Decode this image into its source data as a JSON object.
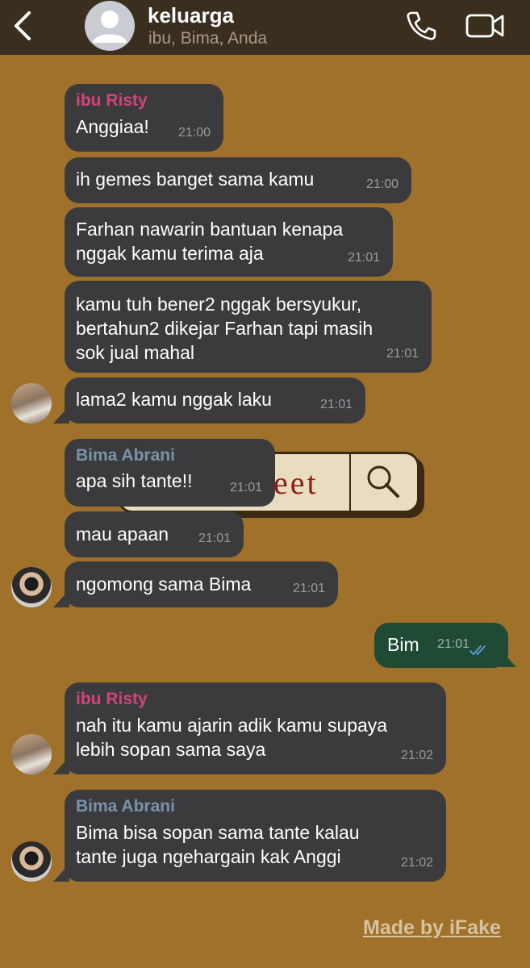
{
  "header": {
    "title": "keluarga",
    "subtitle": "ibu, Bima, Anda"
  },
  "messages": [
    {
      "sender": "ibu Risty",
      "sender_color": "#d2447a",
      "text": "Anggiaa!",
      "time": "21:00"
    },
    {
      "text": "ih gemes banget sama kamu",
      "time": "21:00"
    },
    {
      "text": "Farhan nawarin bantuan kenapa\nnggak kamu terima aja",
      "time": "21:01"
    },
    {
      "text": "kamu tuh bener2 nggak bersyukur,\nbertahun2 dikejar Farhan tapi masih\nsok jual mahal",
      "time": "21:01"
    },
    {
      "text": "lama2 kamu nggak laku",
      "time": "21:01"
    },
    {
      "sender": "Bima Abrani",
      "sender_color": "#7a92a8",
      "text": "apa sih tante!!",
      "time": "21:01"
    },
    {
      "text": "mau apaan",
      "time": "21:01"
    },
    {
      "text": "ngomong sama Bima",
      "time": "21:01"
    },
    {
      "text": "Bim",
      "time": "21:01",
      "outgoing": true
    },
    {
      "sender": "ibu Risty",
      "sender_color": "#d2447a",
      "text": "nah itu kamu ajarin adik kamu supaya\nlebih sopan sama saya",
      "time": "21:02"
    },
    {
      "sender": "Bima Abrani",
      "sender_color": "#7a92a8",
      "text": "Bima bisa sopan sama tante kalau\ntante juga ngehargain kak Anggi",
      "time": "21:02"
    }
  ],
  "sticker": {
    "text": "eet"
  },
  "watermark": "Made by iFake",
  "colors": {
    "background": "#a0712a",
    "header": "#3a2e1f",
    "incoming_bubble": "#3b3b3e",
    "outgoing_bubble": "#1f4a34",
    "read_ticks": "#5aa0e0"
  }
}
